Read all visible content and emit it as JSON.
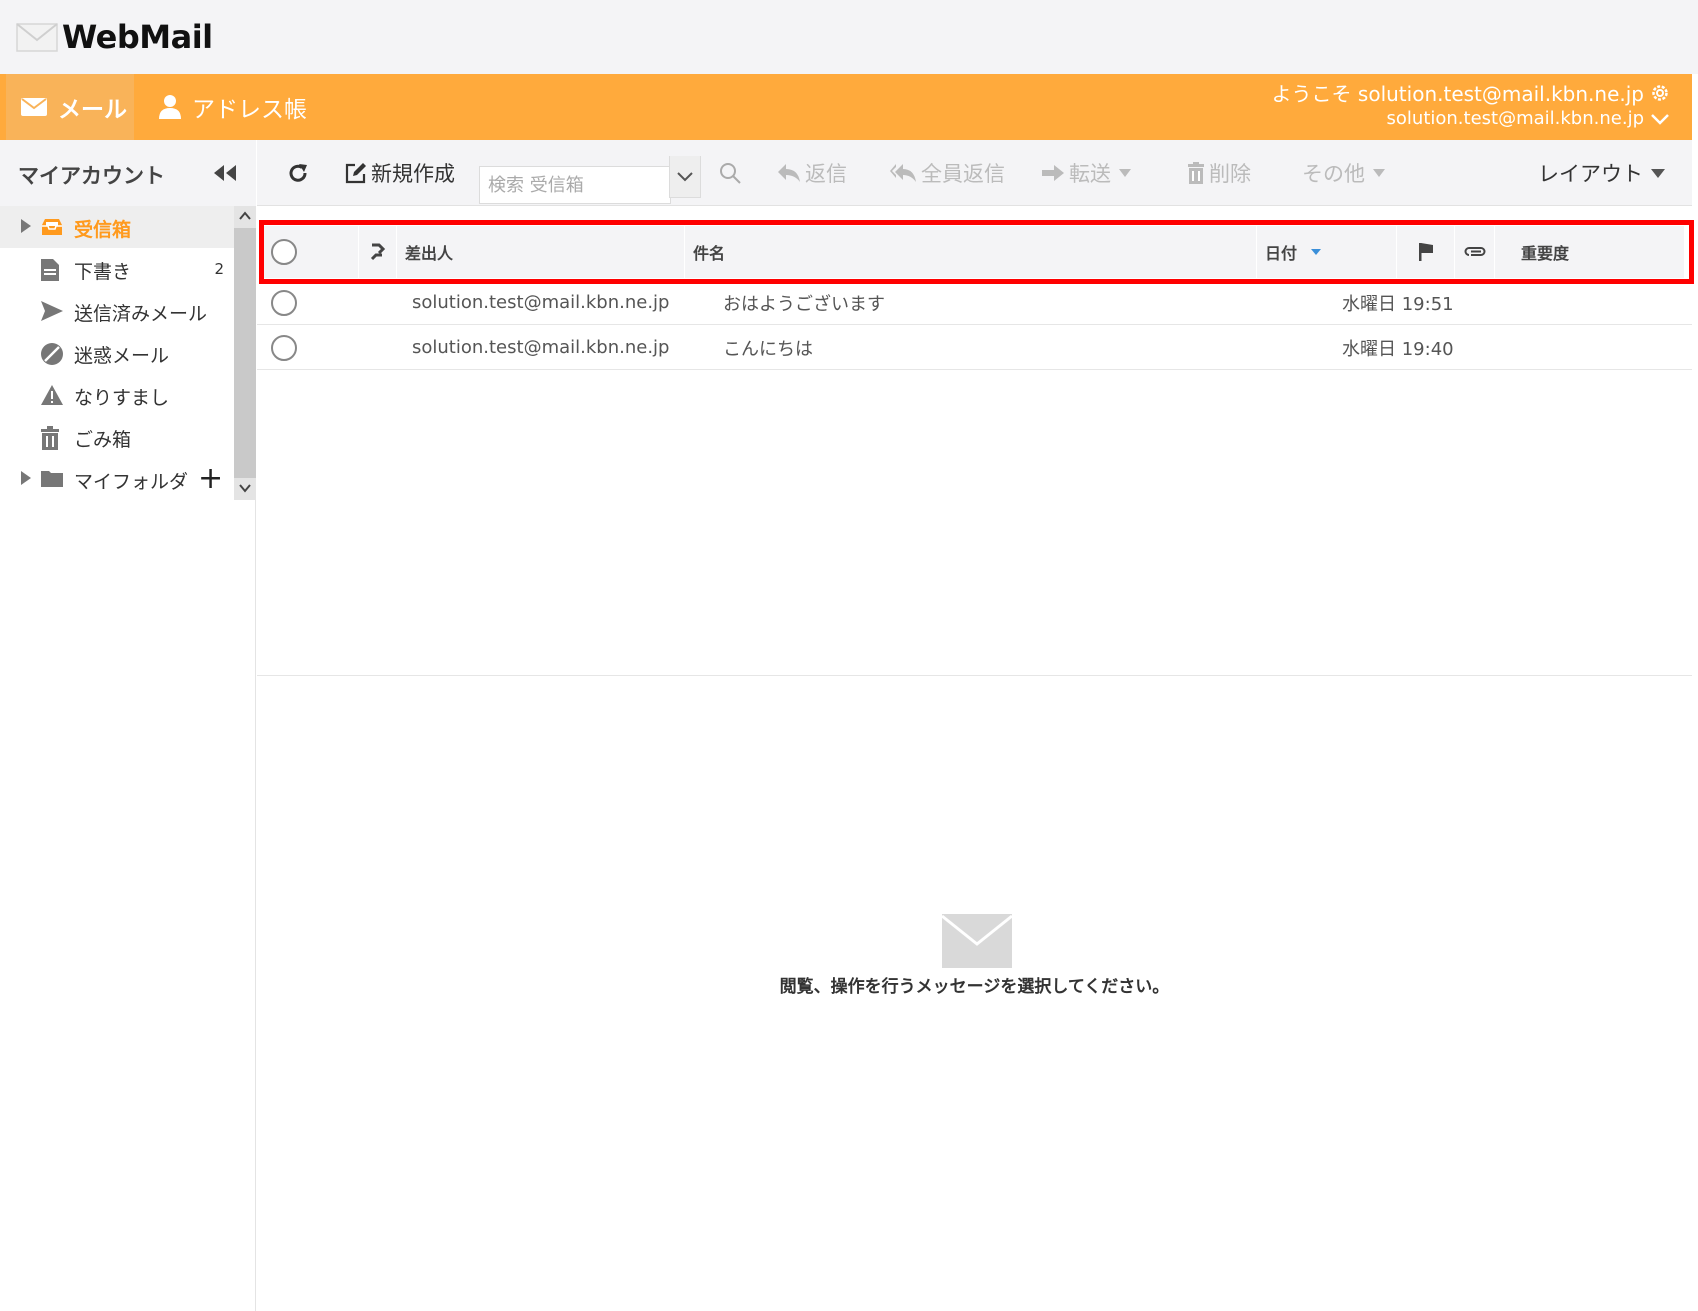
{
  "app": {
    "logo_text": "WebMail"
  },
  "nav": {
    "mail_label": "メール",
    "address_label": "アドレス帳",
    "welcome_text": "ようこそ solution.test@mail.kbn.ne.jp",
    "account_value": "solution.test@mail.kbn.ne.jp"
  },
  "sidebar": {
    "title": "マイアカウント",
    "folders": [
      {
        "label": "受信箱",
        "icon": "inbox-icon",
        "active": true,
        "count": ""
      },
      {
        "label": "下書き",
        "icon": "draft-icon",
        "active": false,
        "count": "2"
      },
      {
        "label": "送信済みメール",
        "icon": "send-icon",
        "active": false,
        "count": ""
      },
      {
        "label": "迷惑メール",
        "icon": "spam-icon",
        "active": false,
        "count": ""
      },
      {
        "label": "なりすまし",
        "icon": "warning-icon",
        "active": false,
        "count": ""
      },
      {
        "label": "ごみ箱",
        "icon": "trash-icon",
        "active": false,
        "count": ""
      },
      {
        "label": "マイフォルダ",
        "icon": "folder-icon",
        "active": false,
        "count": ""
      }
    ]
  },
  "toolbar": {
    "compose_label": "新規作成",
    "search_placeholder": "検索 受信箱",
    "reply_label": "返信",
    "reply_all_label": "全員返信",
    "forward_label": "転送",
    "delete_label": "削除",
    "more_label": "その他",
    "layout_label": "レイアウト"
  },
  "list": {
    "columns": {
      "from": "差出人",
      "subject": "件名",
      "date": "日付",
      "priority": "重要度"
    },
    "messages": [
      {
        "from": "solution.test@mail.kbn.ne.jp",
        "subject": "おはようございます",
        "date": "水曜日 19:51"
      },
      {
        "from": "solution.test@mail.kbn.ne.jp",
        "subject": "こんにちは",
        "date": "水曜日 19:40"
      }
    ]
  },
  "preview": {
    "empty_message": "閲覧、操作を行うメッセージを選択してください。"
  },
  "colors": {
    "accent": "#ffaa3c",
    "active_folder": "#ff9a1e",
    "highlight": "#ff0000"
  }
}
